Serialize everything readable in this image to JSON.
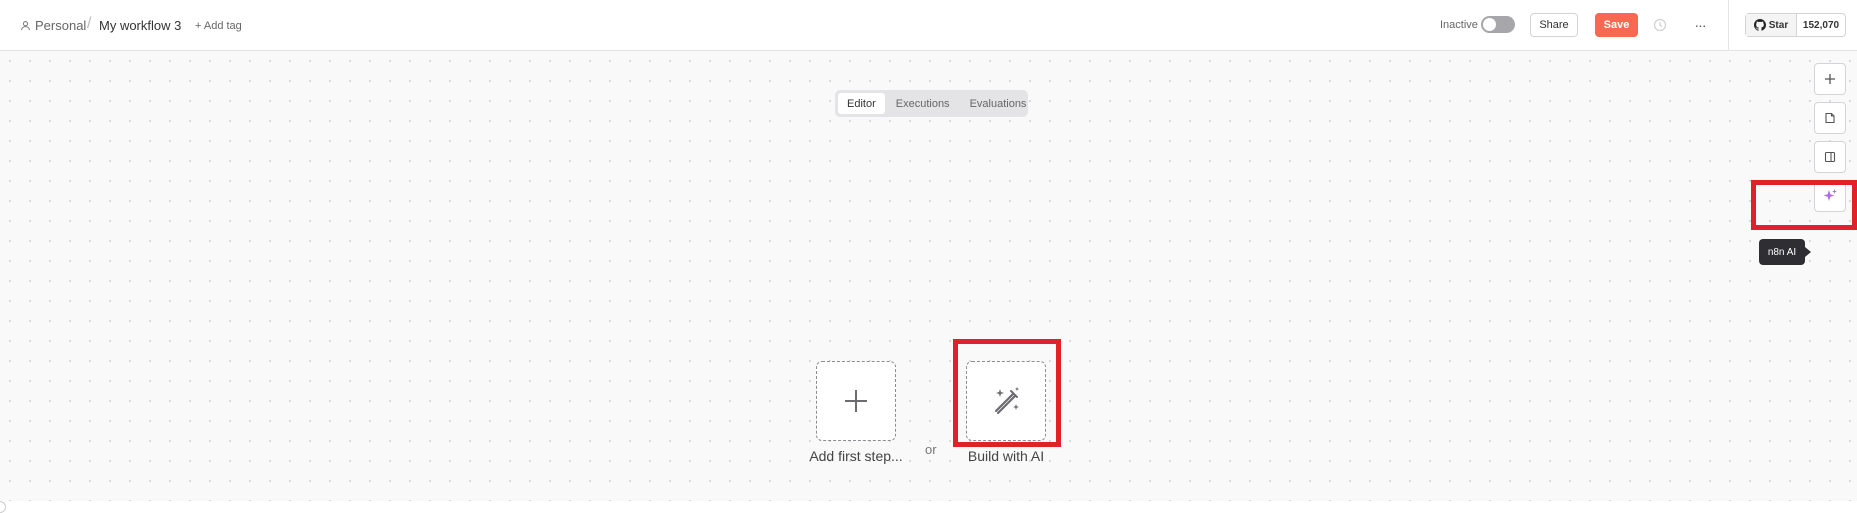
{
  "header": {
    "project": "Personal",
    "separator": "/",
    "workflow_title": "My workflow 3",
    "add_tag_label": "+ Add tag",
    "status_label": "Inactive",
    "share_label": "Share",
    "save_label": "Save",
    "more_label": "···",
    "github": {
      "star_label": "Star",
      "star_count": "152,070"
    }
  },
  "tabs": [
    {
      "label": "Editor",
      "active": true
    },
    {
      "label": "Executions",
      "active": false
    },
    {
      "label": "Evaluations",
      "active": false
    }
  ],
  "canvas": {
    "add_first_step_label": "Add first step...",
    "or_label": "or",
    "build_with_ai_label": "Build with AI"
  },
  "right_toolbar": {
    "tools": [
      "plus-icon",
      "sticky-note-icon",
      "panel-icon",
      "sparkle-icon"
    ],
    "tooltip": "n8n AI"
  },
  "colors": {
    "save": "#f76a51",
    "highlight": "#e0212a",
    "ai_accent": "#b06ae8",
    "toggle_off": "#a6a6ab"
  }
}
